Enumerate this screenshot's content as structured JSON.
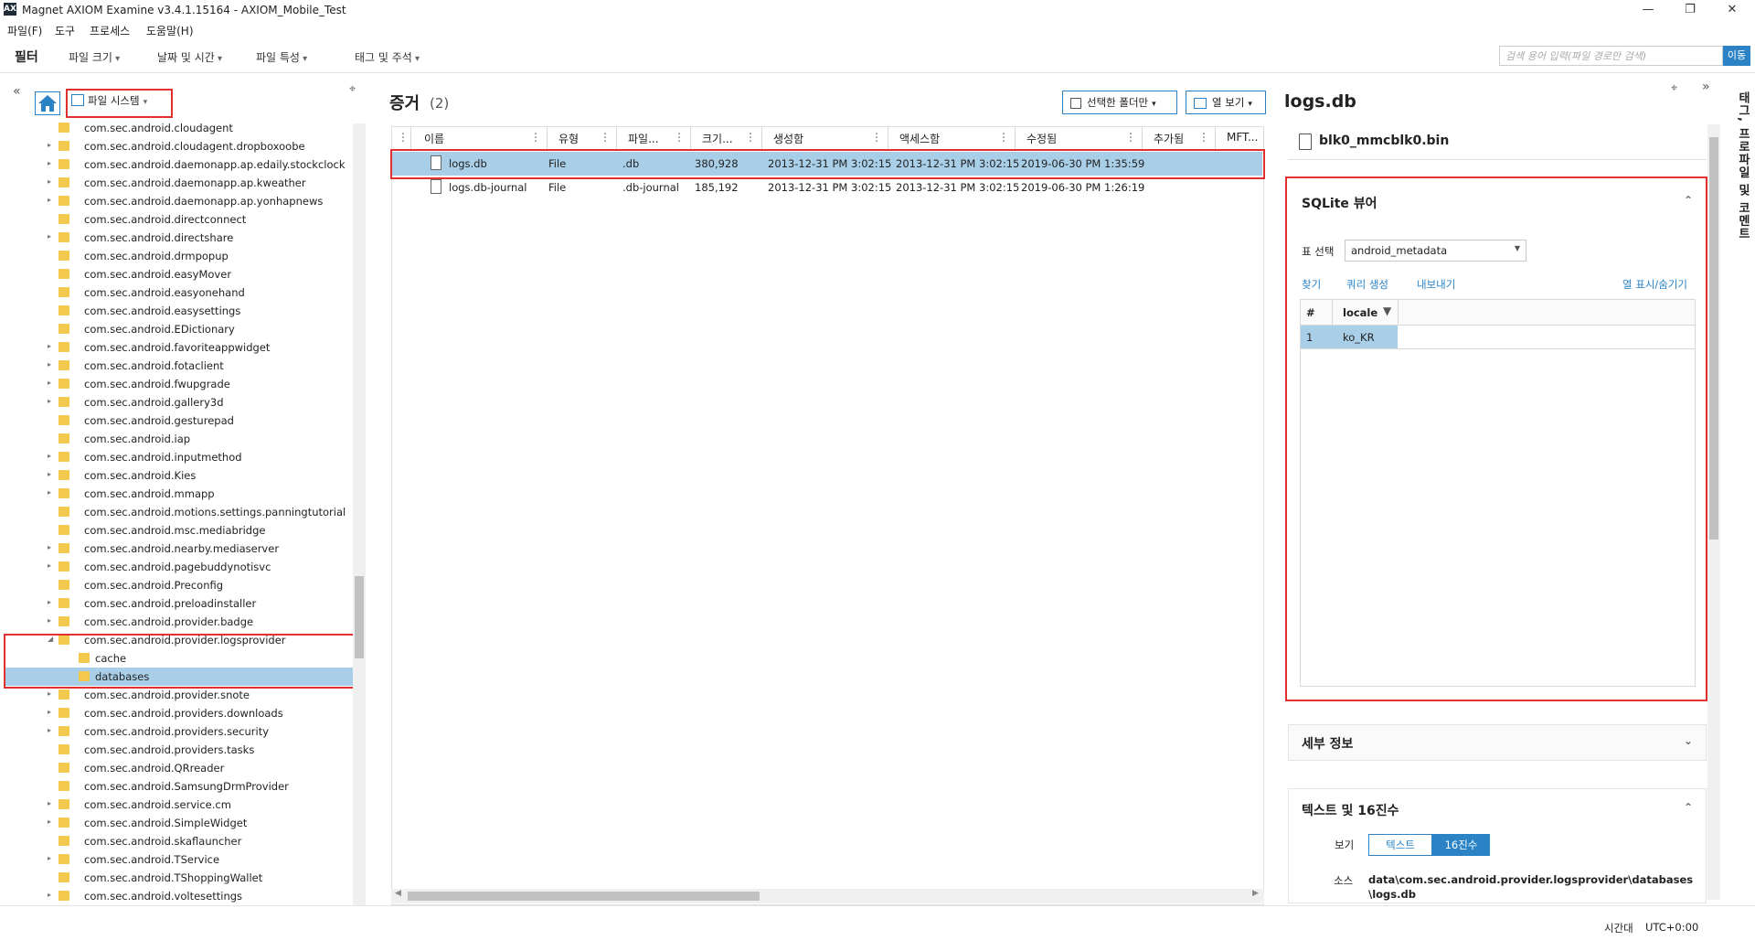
{
  "window": {
    "title": "Magnet AXIOM Examine v3.4.1.15164 - AXIOM_Mobile_Test",
    "app_icon": "AX",
    "controls": {
      "minimize": "—",
      "restore": "❐",
      "close": "✕"
    }
  },
  "menu": [
    "파일(F)",
    "도구",
    "프로세스",
    "도움말(H)"
  ],
  "filterbar": {
    "title": "필터",
    "dropdowns": [
      "파일 크기",
      "날짜 및 시간",
      "파일 특성",
      "태그 및 주석"
    ],
    "search_placeholder": "검색 용어 입력(파일 경로만 검색)",
    "go_label": "이동"
  },
  "left": {
    "collapse_glyph": "«",
    "view_selector": "파일 시스템",
    "pin_glyph": "⌖",
    "tree": [
      {
        "label": "com.sec.android.cloudagent",
        "expandable": false
      },
      {
        "label": "com.sec.android.cloudagent.dropboxoobe",
        "expandable": true
      },
      {
        "label": "com.sec.android.daemonapp.ap.edaily.stockclock",
        "expandable": true
      },
      {
        "label": "com.sec.android.daemonapp.ap.kweather",
        "expandable": true
      },
      {
        "label": "com.sec.android.daemonapp.ap.yonhapnews",
        "expandable": true
      },
      {
        "label": "com.sec.android.directconnect",
        "expandable": false
      },
      {
        "label": "com.sec.android.directshare",
        "expandable": true
      },
      {
        "label": "com.sec.android.drmpopup",
        "expandable": false
      },
      {
        "label": "com.sec.android.easyMover",
        "expandable": false
      },
      {
        "label": "com.sec.android.easyonehand",
        "expandable": false
      },
      {
        "label": "com.sec.android.easysettings",
        "expandable": false
      },
      {
        "label": "com.sec.android.EDictionary",
        "expandable": false
      },
      {
        "label": "com.sec.android.favoriteappwidget",
        "expandable": true
      },
      {
        "label": "com.sec.android.fotaclient",
        "expandable": true
      },
      {
        "label": "com.sec.android.fwupgrade",
        "expandable": true
      },
      {
        "label": "com.sec.android.gallery3d",
        "expandable": true
      },
      {
        "label": "com.sec.android.gesturepad",
        "expandable": false
      },
      {
        "label": "com.sec.android.iap",
        "expandable": false
      },
      {
        "label": "com.sec.android.inputmethod",
        "expandable": true
      },
      {
        "label": "com.sec.android.Kies",
        "expandable": true
      },
      {
        "label": "com.sec.android.mmapp",
        "expandable": true
      },
      {
        "label": "com.sec.android.motions.settings.panningtutorial",
        "expandable": false
      },
      {
        "label": "com.sec.android.msc.mediabridge",
        "expandable": false
      },
      {
        "label": "com.sec.android.nearby.mediaserver",
        "expandable": true
      },
      {
        "label": "com.sec.android.pagebuddynotisvc",
        "expandable": true
      },
      {
        "label": "com.sec.android.Preconfig",
        "expandable": false
      },
      {
        "label": "com.sec.android.preloadinstaller",
        "expandable": true
      },
      {
        "label": "com.sec.android.provider.badge",
        "expandable": true
      },
      {
        "label": "com.sec.android.provider.logsprovider",
        "expandable": true,
        "expanded": true
      },
      {
        "label": "cache",
        "child": true
      },
      {
        "label": "databases",
        "child": true,
        "selected": true
      },
      {
        "label": "com.sec.android.provider.snote",
        "expandable": true
      },
      {
        "label": "com.sec.android.providers.downloads",
        "expandable": true
      },
      {
        "label": "com.sec.android.providers.security",
        "expandable": true
      },
      {
        "label": "com.sec.android.providers.tasks",
        "expandable": false
      },
      {
        "label": "com.sec.android.QRreader",
        "expandable": false
      },
      {
        "label": "com.sec.android.SamsungDrmProvider",
        "expandable": false
      },
      {
        "label": "com.sec.android.service.cm",
        "expandable": true
      },
      {
        "label": "com.sec.android.SimpleWidget",
        "expandable": true
      },
      {
        "label": "com.sec.android.skaflauncher",
        "expandable": false
      },
      {
        "label": "com.sec.android.TService",
        "expandable": true
      },
      {
        "label": "com.sec.android.TShoppingWallet",
        "expandable": false
      },
      {
        "label": "com.sec.android.voltesettings",
        "expandable": true
      }
    ]
  },
  "center": {
    "title": "증거",
    "count": "(2)",
    "btn_selected_folder": "선택한 폴더만",
    "btn_column_view": "열 보기",
    "columns": [
      "이름",
      "유형",
      "파일...",
      "크기...",
      "생성함",
      "액세스함",
      "수정됨",
      "추가됨",
      "MFT..."
    ],
    "rows": [
      {
        "name": "logs.db",
        "type": "File",
        "ext": ".db",
        "size": "380,928",
        "created": "2013-12-31 PM 3:02:15",
        "accessed": "2013-12-31 PM 3:02:15",
        "modified": "2019-06-30 PM 1:35:59",
        "selected": true
      },
      {
        "name": "logs.db-journal",
        "type": "File",
        "ext": ".db-journal",
        "size": "185,192",
        "created": "2013-12-31 PM 3:02:15",
        "accessed": "2013-12-31 PM 3:02:15",
        "modified": "2019-06-30 PM 1:26:19",
        "selected": false
      }
    ]
  },
  "right": {
    "title": "logs.db",
    "source_file": "blk0_mmcblk0.bin",
    "sqlite": {
      "header": "SQLite 뷰어",
      "table_select_label": "표 선택",
      "table_selected": "android_metadata",
      "actions": {
        "find": "찾기",
        "query": "쿼리 생성",
        "export": "내보내기",
        "toggle_cols": "열 표시/숨기기"
      },
      "col_num": "#",
      "col_locale": "locale",
      "row_num": "1",
      "row_locale": "ko_KR"
    },
    "details_header": "세부 정보",
    "hex": {
      "header": "텍스트 및 16진수",
      "view_label": "보기",
      "tab_text": "텍스트",
      "tab_hex": "16진수",
      "source_label": "소스",
      "source_line1": "data\\com.sec.android.provider.logsprovider\\databases",
      "source_line2": "\\logs.db"
    },
    "side_tab": "태그, 프로파일 및 코멘트"
  },
  "status": {
    "label": "시간대",
    "value": "UTC+0:00"
  },
  "colors": {
    "accent": "#2b83c6",
    "selection": "#a9cfe8",
    "highlight_box": "#e03030",
    "folder": "#f2c94c"
  }
}
